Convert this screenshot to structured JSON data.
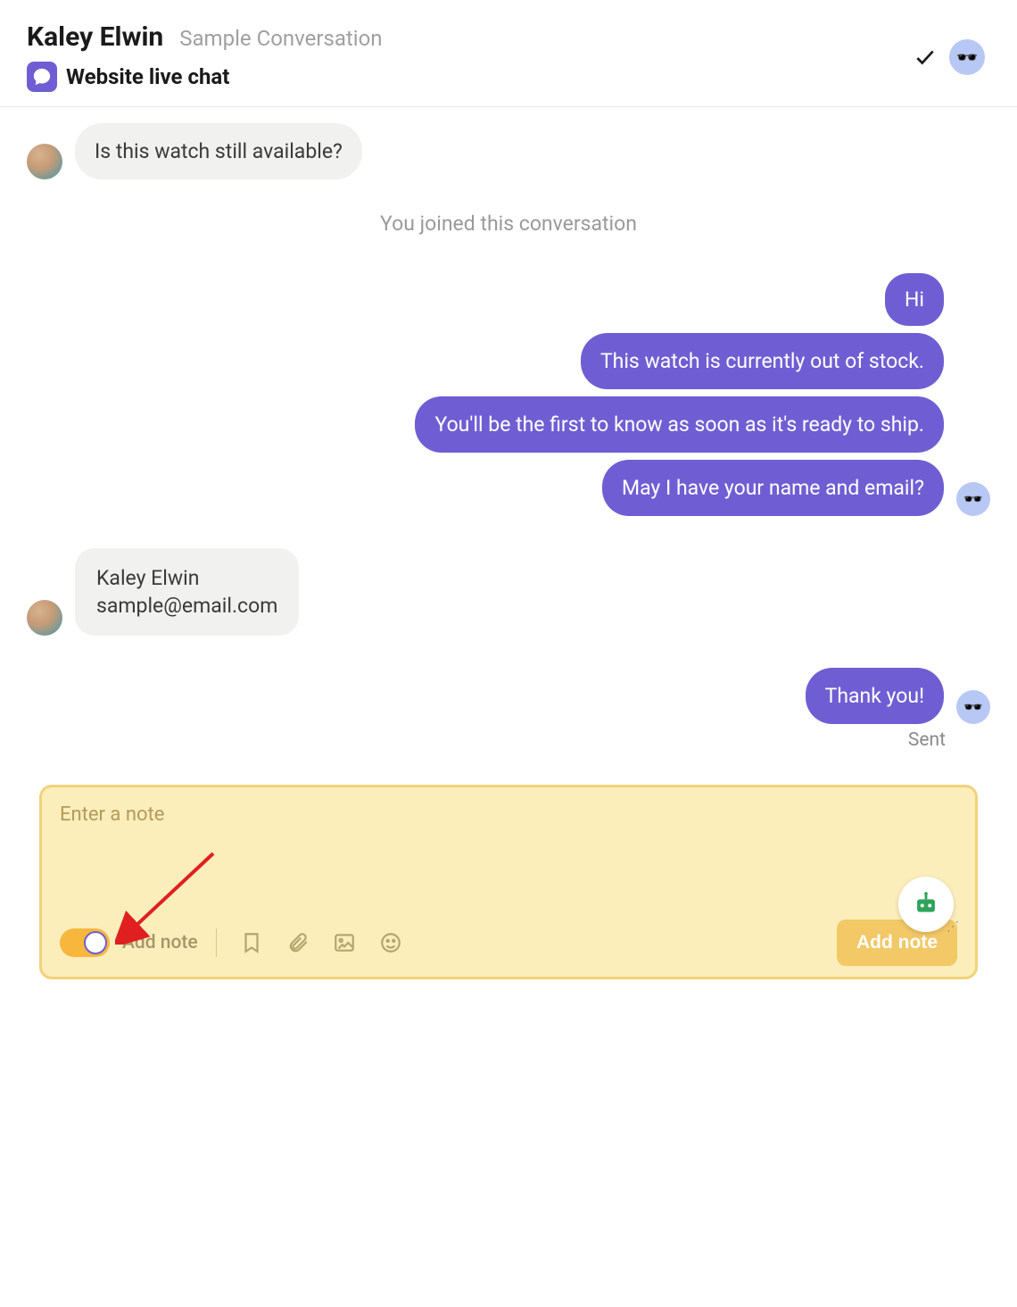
{
  "header": {
    "contact_name": "Kaley Elwin",
    "subtitle": "Sample Conversation",
    "channel_label": "Website live chat"
  },
  "system_message": "You joined this conversation",
  "messages": {
    "m1": "Is this watch still available?",
    "m2": "Hi",
    "m3": "This watch is currently out of stock.",
    "m4": "You'll be the first to know as soon as it's ready to ship.",
    "m5": "May I have your name and email?",
    "m6_line1": "Kaley Elwin",
    "m6_line2": "sample@email.com",
    "m7": "Thank you!"
  },
  "status_label": "Sent",
  "note": {
    "placeholder": "Enter a note",
    "toggle_label": "Add note",
    "button_label": "Add note"
  },
  "agent_emoji": "🕶️"
}
